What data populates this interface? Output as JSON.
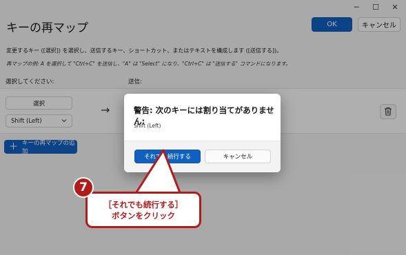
{
  "window": {
    "controls": {
      "minimize": "─",
      "maximize": "☐",
      "close": "✕"
    }
  },
  "header": {
    "title": "キーの再マップ",
    "ok_label": "OK",
    "cancel_label": "キャンセル"
  },
  "description": {
    "line1": "変更するキー ([選択]) を選択し、送信するキー、ショートカット、またはテキストを構成します ([送信する])。",
    "line2": "再マップの例: A を選択して \"Ctrl+C\" を送信し、\"A\" は \"Select\" になり、\"Ctrl+C\" は \"送信する\" コマンドになります。"
  },
  "columns": {
    "select_header": "選択してください:",
    "send_header": "送信:"
  },
  "mapping_row": {
    "select_button": "選択",
    "selected_key": "Shift (Left)",
    "dropdown_icon": "chevron-down-icon",
    "arrow": "→",
    "delete_icon": "trash-icon"
  },
  "add_button": {
    "icon": "plus-icon",
    "label": "キーの再マップの追加"
  },
  "dialog": {
    "title": "警告: 次のキーには割り当てがありません:",
    "body": "Shift (Left)",
    "continue_label": "それでも続行する",
    "cancel_label": "キャンセル"
  },
  "callout": {
    "number": "7",
    "line1": "［それでも続行する］",
    "line2": "ボタンをクリック",
    "color": "#b31b1b"
  },
  "colors": {
    "accent": "#1060c0",
    "overlay": "rgba(0,0,0,0.30)"
  }
}
